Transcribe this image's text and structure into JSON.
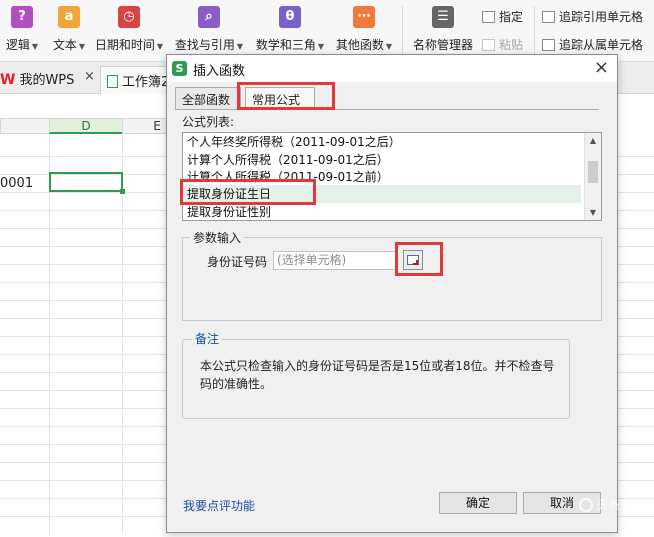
{
  "ribbon": {
    "groups": [
      {
        "label": "逻辑",
        "icon": "logic-function-icon",
        "color": "#b04fbf",
        "glyph": "?"
      },
      {
        "label": "文本",
        "icon": "text-function-icon",
        "color": "#f0a43a",
        "glyph": "a"
      },
      {
        "label": "日期和时间",
        "icon": "datetime-function-icon",
        "color": "#d64545",
        "glyph": "◷"
      },
      {
        "label": "查找与引用",
        "icon": "lookup-function-icon",
        "color": "#8a5cc7",
        "glyph": "⌕"
      },
      {
        "label": "数学和三角",
        "icon": "math-function-icon",
        "color": "#7b62c9",
        "glyph": "θ"
      },
      {
        "label": "其他函数",
        "icon": "other-function-icon",
        "color": "#ef7a3c",
        "glyph": "⋯"
      },
      {
        "label": "名称管理器",
        "icon": "name-manager-icon",
        "color": "#666666",
        "glyph": "☰"
      }
    ],
    "specify_label": "指定",
    "paste_label": "粘贴",
    "trace_precedents_label": "追踪引用单元格",
    "trace_dependents_label": "追踪从属单元格"
  },
  "tabs": {
    "wps_label": "我的WPS",
    "close_glyph": "×",
    "doc_label": "工作簿2"
  },
  "sheet": {
    "columns": [
      "D",
      "E"
    ],
    "cell_value": "0001"
  },
  "dialog": {
    "title": "插入函数",
    "close_glyph": "×",
    "tabs": [
      "全部函数",
      "常用公式"
    ],
    "formula_list_label": "公式列表:",
    "formulas": [
      "个人年终奖所得税（2011-09-01之后）",
      "计算个人所得税（2011-09-01之后）",
      "计算个人所得税（2011-09-01之前）",
      "提取身份证生日",
      "提取身份证性别"
    ],
    "selected_formula_index": 3,
    "params_title": "参数输入",
    "param_label": "身份证号码",
    "param_placeholder": "(选择单元格)",
    "note_title": "备注",
    "note_text": "本公式只检查输入的身份证号码是否是15位或者18位。并不检查号码的准确性。",
    "feedback_link": "我要点评功能",
    "ok_label": "确定",
    "cancel_label": "取消"
  },
  "watermark": "头条号",
  "colors": {
    "accent_green": "#2e9b4e",
    "highlight_red": "#e23a3a",
    "link_blue": "#1a4ea0"
  }
}
